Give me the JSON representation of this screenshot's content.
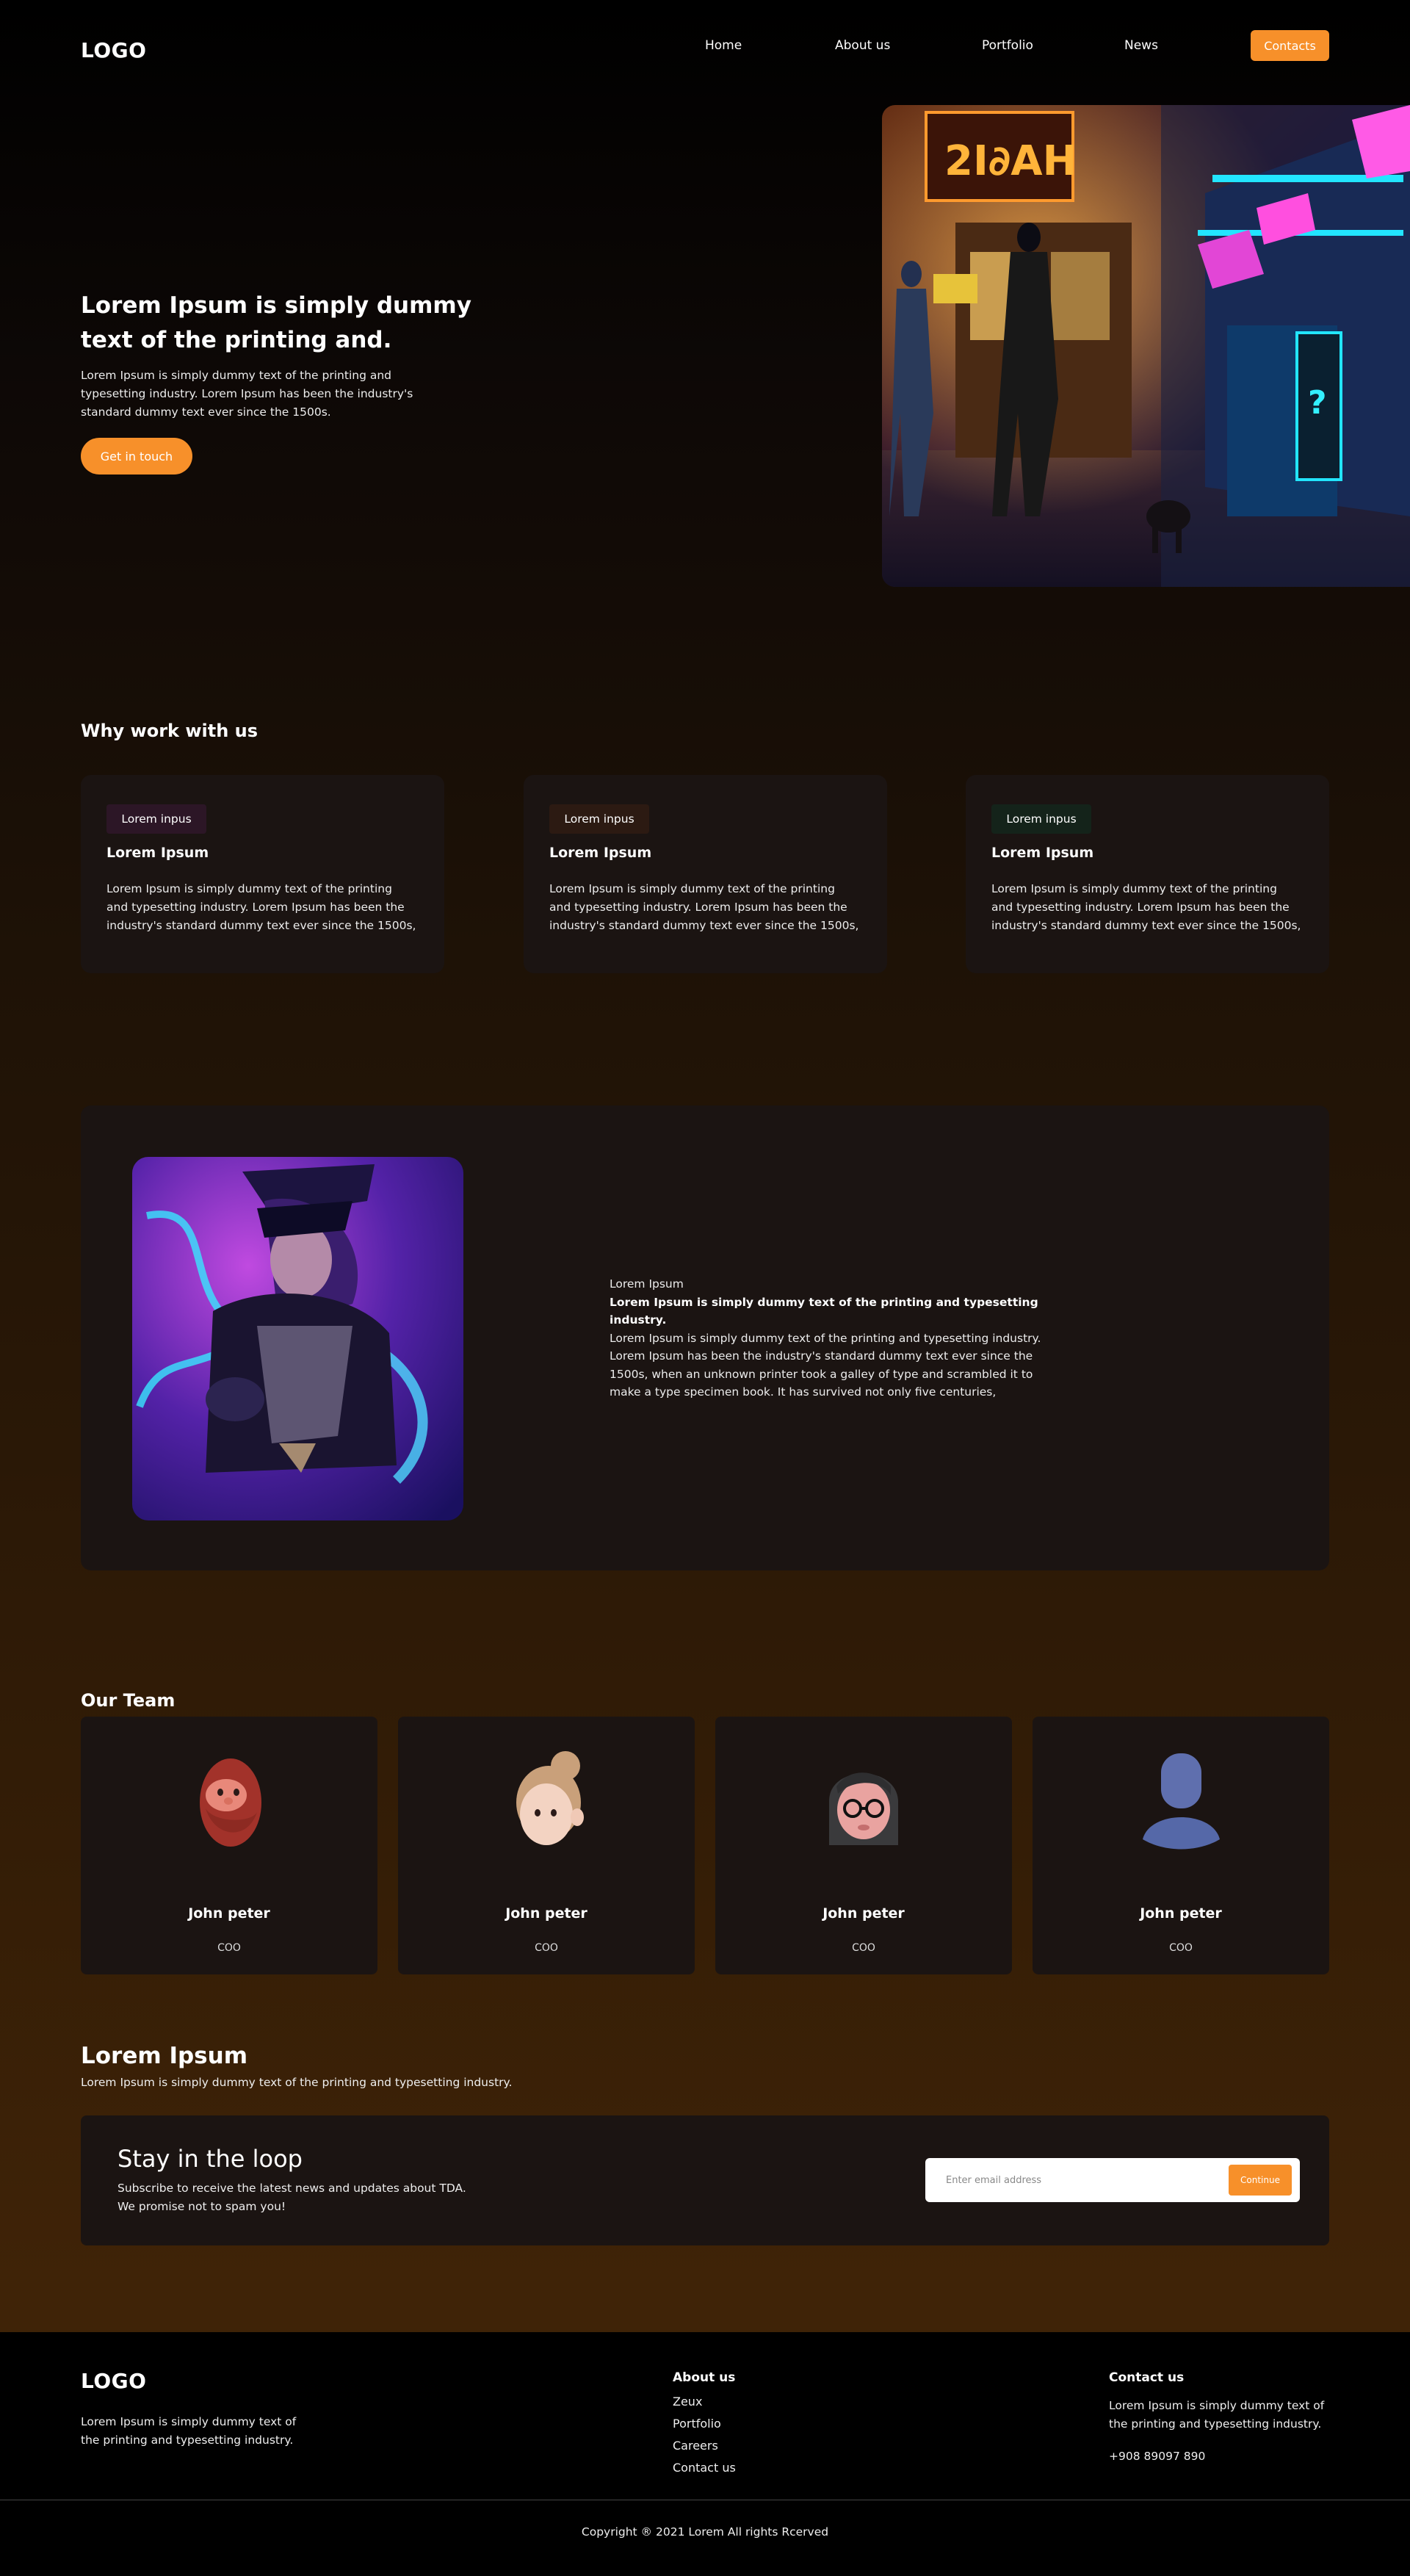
{
  "nav": {
    "logo": "LOGO",
    "links": [
      "Home",
      "About us",
      "Portfolio",
      "News"
    ],
    "cta": "Contacts"
  },
  "hero": {
    "title_line1": "Lorem Ipsum is simply dummy",
    "title_line2": "text of the printing and.",
    "body_lines": [
      "Lorem Ipsum is simply dummy text of the printing and",
      "typesetting industry. Lorem Ipsum has been the industry's",
      "standard dummy text ever since the 1500s."
    ],
    "button": "Get in touch"
  },
  "why": {
    "heading": "Why work with us",
    "cards": [
      {
        "tag": "Lorem inpus",
        "title": "Lorem Ipsum",
        "lines": [
          "Lorem Ipsum is simply dummy text of the printing",
          "and typesetting industry. Lorem Ipsum has been the",
          "industry's standard dummy text ever since the 1500s,"
        ]
      },
      {
        "tag": "Lorem inpus",
        "title": "Lorem Ipsum",
        "lines": [
          "Lorem Ipsum is simply dummy text of the printing",
          "and typesetting industry. Lorem Ipsum has been the",
          "industry's standard dummy text ever since the 1500s,"
        ]
      },
      {
        "tag": "Lorem inpus",
        "title": "Lorem Ipsum",
        "lines": [
          "Lorem Ipsum is simply dummy text of the printing",
          "and typesetting industry. Lorem Ipsum has been the",
          "industry's standard dummy text ever since the 1500s,"
        ]
      }
    ],
    "tag_colors": [
      "#2c1626",
      "#2c1a12",
      "#14231a"
    ]
  },
  "feature": {
    "label": "Lorem Ipsum",
    "bold_line1": "Lorem Ipsum is simply dummy text of the printing and typesetting",
    "bold_line2": "industry.",
    "body_lines": [
      "Lorem Ipsum is simply dummy text of the printing and typesetting industry.",
      "Lorem Ipsum has been the industry's standard dummy text ever since the",
      "1500s, when an unknown printer took a galley of type and scrambled it to",
      "make a type specimen book. It has survived not only five centuries,"
    ]
  },
  "team": {
    "heading": "Our Team",
    "members": [
      {
        "name": "John peter",
        "role": "COO",
        "avatar": "bearded-man-avatar-icon"
      },
      {
        "name": "John peter",
        "role": "COO",
        "avatar": "woman-bun-avatar-icon"
      },
      {
        "name": "John peter",
        "role": "COO",
        "avatar": "woman-glasses-avatar-icon"
      },
      {
        "name": "John peter",
        "role": "COO",
        "avatar": "generic-user-avatar-icon"
      }
    ]
  },
  "promo": {
    "title": "Lorem Ipsum",
    "subtitle": "Lorem Ipsum is simply dummy text of the printing and typesetting industry."
  },
  "newsletter": {
    "title": "Stay in the loop",
    "line1": "Subscribe to receive the latest news and updates about TDA.",
    "line2": "We promise not to spam you!",
    "placeholder": "Enter email address",
    "button": "Continue"
  },
  "footer": {
    "logo": "LOGO",
    "about_lines": [
      "Lorem Ipsum is simply dummy text of",
      "the printing and typesetting industry."
    ],
    "about_heading": "About us",
    "about_links": [
      "Zeux",
      "Portfolio",
      "Careers",
      "Contact us"
    ],
    "contact_heading": "Contact us",
    "contact_lines": [
      "Lorem Ipsum is simply dummy text of",
      "the printing and typesetting industry."
    ],
    "phone": "+908 89097 890",
    "copyright": "Copyright ® 2021 Lorem All rights Rcerved"
  },
  "colors": {
    "accent": "#f7902a",
    "card_bg": "#1b1412"
  }
}
